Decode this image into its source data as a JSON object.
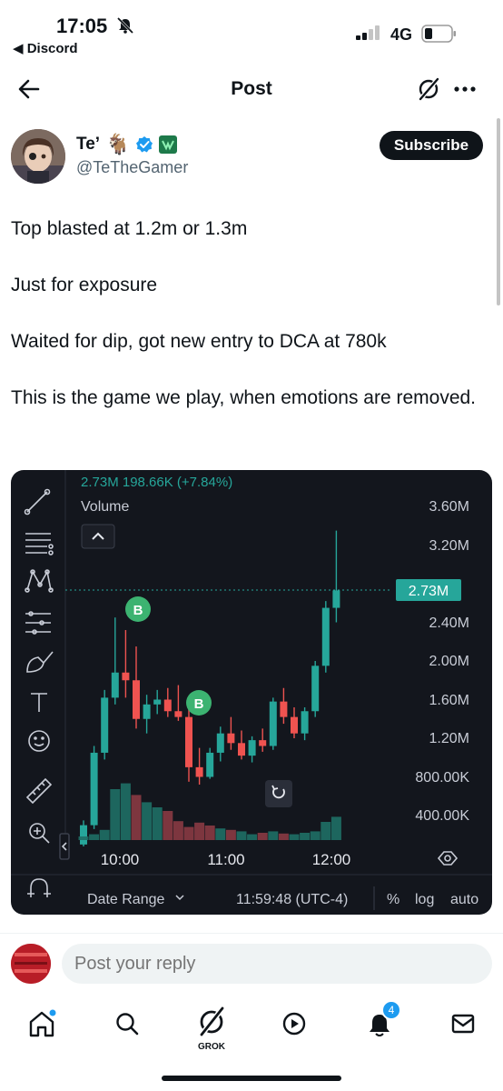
{
  "status_bar": {
    "time": "17:05",
    "back_app": "◀ Discord",
    "network": "4G"
  },
  "header": {
    "title": "Post",
    "icons": [
      "back-arrow-icon",
      "grok-icon",
      "more-icon"
    ]
  },
  "author": {
    "name": "Te’",
    "emoji": "🐐",
    "handle": "@TeTheGamer",
    "verified_color": "#1d9bf0",
    "subscribe_label": "Subscribe"
  },
  "post": {
    "paragraphs": [
      "Top blasted at 1.2m or 1.3m",
      "Just for exposure",
      "Waited for dip, got new entry to DCA at 780k",
      "This is the game we play, when emotions are removed."
    ]
  },
  "chart_data": {
    "type": "candlestick",
    "legend_line": "2.73M  198.66K (+7.84%)",
    "volume_label": "Volume",
    "price_axis": [
      "3.60M",
      "3.20M",
      "2.40M",
      "2.00M",
      "1.60M",
      "1.20M",
      "800.00K",
      "400.00K"
    ],
    "current_price": "2.73M",
    "time_axis": [
      "10:00",
      "11:00",
      "12:00"
    ],
    "markers": [
      "B",
      "B"
    ],
    "up_color": "#26a69a",
    "down_color": "#ef5350",
    "candles": [
      {
        "o": 0.1,
        "h": 0.35,
        "l": 0.08,
        "c": 0.3
      },
      {
        "o": 0.3,
        "h": 1.12,
        "l": 0.26,
        "c": 1.05
      },
      {
        "o": 1.05,
        "h": 1.7,
        "l": 0.98,
        "c": 1.62
      },
      {
        "o": 1.62,
        "h": 2.45,
        "l": 1.55,
        "c": 1.88
      },
      {
        "o": 1.88,
        "h": 2.32,
        "l": 1.62,
        "c": 1.8
      },
      {
        "o": 1.8,
        "h": 2.15,
        "l": 1.3,
        "c": 1.4
      },
      {
        "o": 1.4,
        "h": 1.65,
        "l": 1.25,
        "c": 1.55
      },
      {
        "o": 1.55,
        "h": 1.7,
        "l": 1.45,
        "c": 1.6
      },
      {
        "o": 1.6,
        "h": 1.72,
        "l": 1.42,
        "c": 1.48
      },
      {
        "o": 1.48,
        "h": 1.75,
        "l": 1.38,
        "c": 1.42
      },
      {
        "o": 1.42,
        "h": 1.62,
        "l": 0.75,
        "c": 0.9
      },
      {
        "o": 0.9,
        "h": 1.1,
        "l": 0.72,
        "c": 0.8
      },
      {
        "o": 0.8,
        "h": 1.1,
        "l": 0.78,
        "c": 1.05
      },
      {
        "o": 1.05,
        "h": 1.32,
        "l": 0.96,
        "c": 1.25
      },
      {
        "o": 1.25,
        "h": 1.42,
        "l": 1.08,
        "c": 1.15
      },
      {
        "o": 1.15,
        "h": 1.28,
        "l": 0.98,
        "c": 1.02
      },
      {
        "o": 1.02,
        "h": 1.22,
        "l": 0.95,
        "c": 1.18
      },
      {
        "o": 1.18,
        "h": 1.3,
        "l": 1.06,
        "c": 1.12
      },
      {
        "o": 1.12,
        "h": 1.62,
        "l": 1.08,
        "c": 1.58
      },
      {
        "o": 1.58,
        "h": 1.72,
        "l": 1.35,
        "c": 1.42
      },
      {
        "o": 1.42,
        "h": 1.52,
        "l": 1.2,
        "c": 1.25
      },
      {
        "o": 1.25,
        "h": 1.52,
        "l": 1.18,
        "c": 1.48
      },
      {
        "o": 1.48,
        "h": 2.0,
        "l": 1.42,
        "c": 1.95
      },
      {
        "o": 1.95,
        "h": 2.62,
        "l": 1.88,
        "c": 2.55
      },
      {
        "o": 2.55,
        "h": 3.35,
        "l": 2.4,
        "c": 2.73
      }
    ],
    "volume": [
      {
        "v": 0.05,
        "up": true
      },
      {
        "v": 0.08,
        "up": true
      },
      {
        "v": 0.14,
        "up": true
      },
      {
        "v": 0.7,
        "up": true
      },
      {
        "v": 0.78,
        "up": true
      },
      {
        "v": 0.62,
        "up": false
      },
      {
        "v": 0.52,
        "up": true
      },
      {
        "v": 0.45,
        "up": true
      },
      {
        "v": 0.4,
        "up": false
      },
      {
        "v": 0.26,
        "up": false
      },
      {
        "v": 0.18,
        "up": false
      },
      {
        "v": 0.24,
        "up": false
      },
      {
        "v": 0.2,
        "up": false
      },
      {
        "v": 0.16,
        "up": true
      },
      {
        "v": 0.14,
        "up": false
      },
      {
        "v": 0.12,
        "up": true
      },
      {
        "v": 0.08,
        "up": true
      },
      {
        "v": 0.1,
        "up": false
      },
      {
        "v": 0.12,
        "up": true
      },
      {
        "v": 0.09,
        "up": false
      },
      {
        "v": 0.08,
        "up": true
      },
      {
        "v": 0.1,
        "up": true
      },
      {
        "v": 0.12,
        "up": true
      },
      {
        "v": 0.25,
        "up": true
      },
      {
        "v": 0.32,
        "up": true
      }
    ],
    "footer": {
      "date_range": "Date Range",
      "clock": "11:59:48 (UTC-4)",
      "percent": "%",
      "log": "log",
      "auto": "auto"
    },
    "tools": [
      "trendline-icon",
      "fib-icon",
      "pattern-icon",
      "forecast-icon",
      "brush-icon",
      "text-icon",
      "emoji-icon",
      "ruler-icon",
      "zoom-in-icon",
      "magnet-icon"
    ]
  },
  "reply": {
    "placeholder": "Post your reply"
  },
  "nav": {
    "items": [
      "home-icon",
      "search-icon",
      "grok-icon",
      "video-icon",
      "notifications-icon",
      "messages-icon"
    ],
    "grok_label": "GROK",
    "notification_count": "4",
    "accent": "#1d9bf0"
  }
}
